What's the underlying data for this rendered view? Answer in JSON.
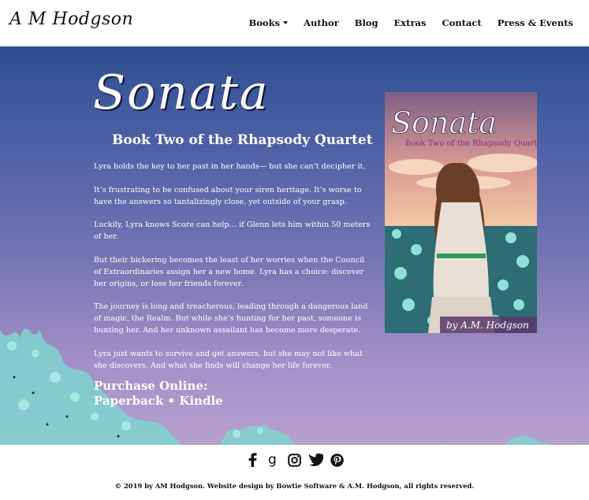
{
  "header": {
    "logo": "A M Hodgson",
    "nav": [
      "Books",
      "Author",
      "Blog",
      "Extras",
      "Contact",
      "Press & Events"
    ]
  },
  "hero": {
    "title": "Sonata",
    "subtitle": "Book Two of the Rhapsody Quartet",
    "paragraphs": [
      "Lyra holds the key to her past in her hands— but she can’t decipher it.",
      "It’s frustrating to be confused about your siren heritage. It’s worse to have the answers so tantalizingly close, yet outside of your grasp.",
      "Luckily, Lyra knows Score can help… if Glenn lets him within 50 meters of her.",
      "But their bickering becomes the least of her worries when the Council of Extraordinaries assign her a new home. Lyra has a choice: discover her origins, or lose her friends forever.",
      "The journey is long and treacherous, leading through a dangerous land of magic, the Realm. But while she’s hunting for her past, someone is hunting her. And her unknown assailant has become more desperate.",
      "Lyra just wants to survive and get answers, but she may not like what she discovers. And what she finds will change her life forever."
    ],
    "purchase_heading": "Purchase Online:",
    "purchase_paperback": "Paperback",
    "purchase_sep": " • ",
    "purchase_kindle": "Kindle"
  },
  "cover": {
    "title": "Sonata",
    "subtitle": "Book Two of the Rhapsody Quartet",
    "author": "by A.M. Hodgson"
  },
  "footer": {
    "social_icons": [
      "facebook-icon",
      "goodreads-icon",
      "instagram-icon",
      "twitter-icon",
      "pinterest-icon"
    ],
    "copyright": "© 2019 by AM Hodgson. Website design by Bowtie Software & A.M. Hodgson, all rights reserved."
  },
  "colors": {
    "hero_top": "#2e4d8f",
    "hero_bottom": "#b7a1d0",
    "flowers": "#7fd3cf"
  }
}
